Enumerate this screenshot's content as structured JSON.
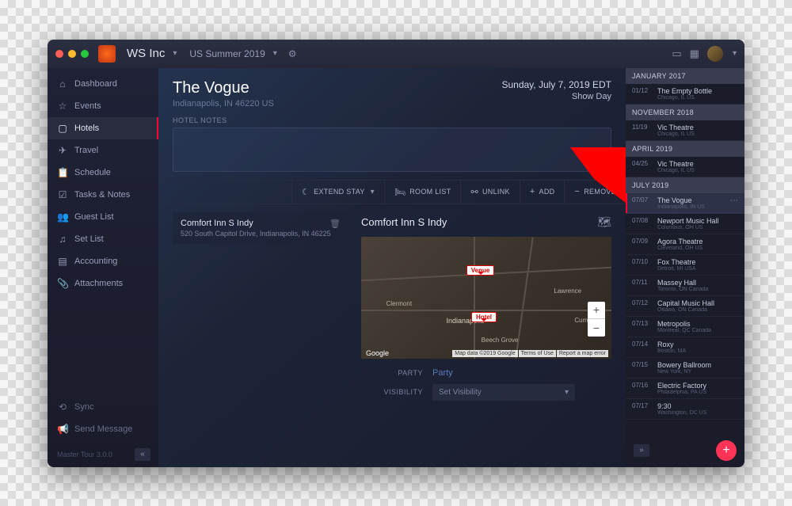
{
  "app": {
    "title": "WS Inc",
    "tour": "US Summer 2019"
  },
  "sidebar": {
    "items": [
      {
        "icon": "⌂",
        "label": "Dashboard"
      },
      {
        "icon": "☆",
        "label": "Events"
      },
      {
        "icon": "▢",
        "label": "Hotels"
      },
      {
        "icon": "✈",
        "label": "Travel"
      },
      {
        "icon": "📋",
        "label": "Schedule"
      },
      {
        "icon": "☑",
        "label": "Tasks & Notes"
      },
      {
        "icon": "👥",
        "label": "Guest List"
      },
      {
        "icon": "♫",
        "label": "Set List"
      },
      {
        "icon": "▤",
        "label": "Accounting"
      },
      {
        "icon": "📎",
        "label": "Attachments"
      }
    ],
    "bottom": [
      {
        "icon": "⟲",
        "label": "Sync"
      },
      {
        "icon": "📢",
        "label": "Send Message"
      }
    ],
    "version": "Master Tour 3.0.0"
  },
  "header": {
    "title": "The Vogue",
    "subtitle": "Indianapolis, IN 46220 US",
    "date": "Sunday, July 7, 2019 EDT",
    "showday": "Show Day"
  },
  "notes": {
    "label": "HOTEL NOTES"
  },
  "toolbar": {
    "extend": "EXTEND STAY",
    "roomlist": "ROOM LIST",
    "unlink": "UNLINK",
    "add": "ADD",
    "remove": "REMOVE"
  },
  "hotel": {
    "name": "Comfort Inn S Indy",
    "address": "520 South Capitol Drive, Indianapolis, IN 46225"
  },
  "detail": {
    "title": "Comfort Inn S Indy",
    "map": {
      "venue_pin": "Venue",
      "hotel_pin": "Hotel",
      "city": "Indianapolis",
      "labels": [
        "Clermont",
        "Lawrence",
        "Beech Grove",
        "Cumb"
      ],
      "attr": "Google",
      "attr2": [
        "Map data ©2019 Google",
        "Terms of Use",
        "Report a map error"
      ]
    },
    "party_label": "PARTY",
    "party_value": "Party",
    "visibility_label": "VISIBILITY",
    "visibility_value": "Set Visibility"
  },
  "timeline": {
    "groups": [
      {
        "month": "JANUARY 2017",
        "events": [
          {
            "date": "01/12",
            "name": "The Empty Bottle",
            "loc": "Chicago, IL US"
          }
        ]
      },
      {
        "month": "NOVEMBER 2018",
        "events": [
          {
            "date": "11/19",
            "name": "Vic Theatre",
            "loc": "Chicago, IL US"
          }
        ]
      },
      {
        "month": "APRIL 2019",
        "events": [
          {
            "date": "04/25",
            "name": "Vic Theatre",
            "loc": "Chicago, IL US"
          }
        ]
      },
      {
        "month": "JULY 2019",
        "events": [
          {
            "date": "07/07",
            "name": "The Vogue",
            "loc": "Indianapolis, IN US",
            "active": true
          },
          {
            "date": "07/08",
            "name": "Newport Music Hall",
            "loc": "Columbus, OH US"
          },
          {
            "date": "07/09",
            "name": "Agora Theatre",
            "loc": "Cleveland, OH US"
          },
          {
            "date": "07/10",
            "name": "Fox Theatre",
            "loc": "Detroit, MI USA"
          },
          {
            "date": "07/11",
            "name": "Massey Hall",
            "loc": "Toronto, ON Canada"
          },
          {
            "date": "07/12",
            "name": "Capital Music Hall",
            "loc": "Ottawa, ON Canada"
          },
          {
            "date": "07/13",
            "name": "Metropolis",
            "loc": "Montreal, QC Canada"
          },
          {
            "date": "07/14",
            "name": "Roxy",
            "loc": "Boston, MA"
          },
          {
            "date": "07/15",
            "name": "Bowery Ballroom",
            "loc": "New York, NY"
          },
          {
            "date": "07/16",
            "name": "Electric Factory",
            "loc": "Philadelphia, PA US"
          },
          {
            "date": "07/17",
            "name": "9:30",
            "loc": "Washington, DC US"
          }
        ]
      }
    ]
  }
}
